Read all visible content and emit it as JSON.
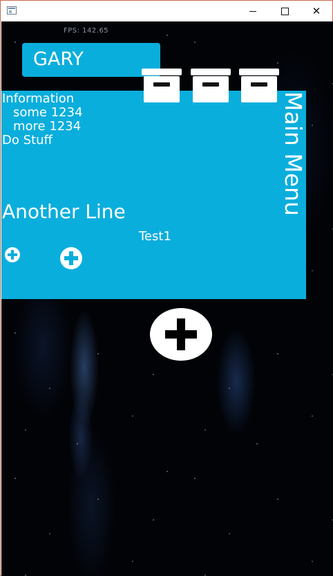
{
  "window": {
    "icon": "app-window-icon",
    "minimize_icon": "minimize-icon",
    "maximize_icon": "maximize-icon",
    "close_glyph": "✕"
  },
  "hud": {
    "fps_text": "FPS: 142.65"
  },
  "name_tab": {
    "label": "GARY"
  },
  "panel": {
    "lines": {
      "information": "Information",
      "some": "some 1234",
      "more": "more 1234",
      "do_stuff": "Do Stuff",
      "another_line": "Another Line",
      "test1": "Test1"
    },
    "menu_title": "Main Menu"
  },
  "icons": {
    "plus": "plus-icon",
    "box": "archive-box-icon"
  },
  "colors": {
    "panel_accent": "#0aaedc",
    "background": "#010307",
    "foreground": "#ffffff"
  }
}
